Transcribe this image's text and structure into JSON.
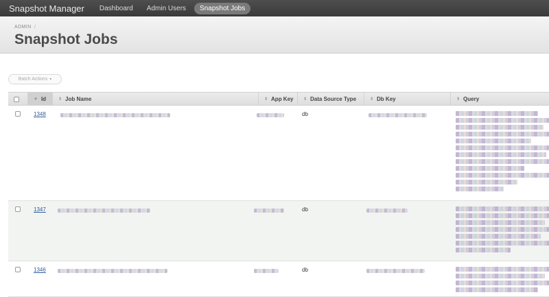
{
  "nav": {
    "brand": "Snapshot Manager",
    "links": [
      {
        "label": "Dashboard",
        "active": false
      },
      {
        "label": "Admin Users",
        "active": false
      },
      {
        "label": "Snapshot Jobs",
        "active": true
      }
    ]
  },
  "header": {
    "breadcrumb": "ADMIN",
    "breadcrumb_sep": "/",
    "title": "Snapshot Jobs"
  },
  "batch_actions": {
    "label": "Batch Actions",
    "caret": "▾"
  },
  "table": {
    "columns": [
      {
        "label": "Id",
        "arrow": "▼"
      },
      {
        "label": "Job Name",
        "arrow": "⇕"
      },
      {
        "label": "App Key",
        "arrow": "⇕"
      },
      {
        "label": "Data Source Type",
        "arrow": "⇕"
      },
      {
        "label": "Db Key",
        "arrow": "⇕"
      },
      {
        "label": "Query",
        "arrow": "⇕"
      }
    ],
    "rows": [
      {
        "id": "1348",
        "data_source_type": "db"
      },
      {
        "id": "1347",
        "data_source_type": "db"
      },
      {
        "id": "1346",
        "data_source_type": "db"
      }
    ]
  },
  "colors": {
    "nav_bg": "#404040",
    "link": "#2b5c9e",
    "row_alt": "#f2f4f2"
  }
}
